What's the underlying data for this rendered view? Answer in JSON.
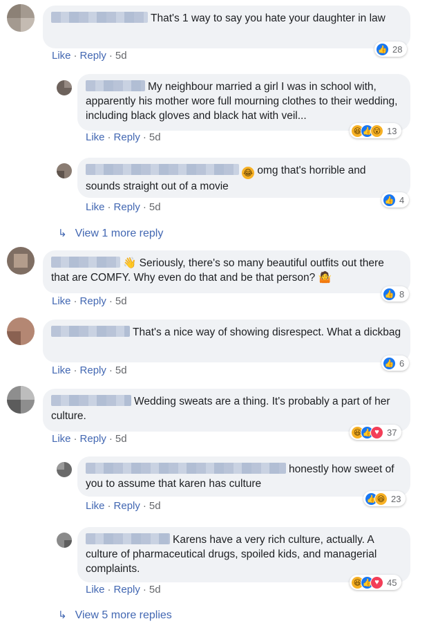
{
  "comments": [
    {
      "text": "That's 1 way to say you hate your daughter in law",
      "reaction_count": "28"
    },
    {
      "text": "My neighbour married a girl I was in school with, apparently his mother wore full mourning clothes to their wedding, including black gloves and black hat with veil...",
      "reaction_count": "13"
    },
    {
      "text": "omg that's horrible and sounds straight out of a movie",
      "reaction_count": "4"
    },
    {
      "text": "Seriously, there's so many beautiful outfits out there that are COMFY. Why even do that and be that person?",
      "reaction_count": "8"
    },
    {
      "text": "That's a nice way of showing disrespect. What a dickbag",
      "reaction_count": "6"
    },
    {
      "text": "Wedding sweats are a thing. It's probably a part of her culture.",
      "reaction_count": "37"
    },
    {
      "text": "honestly how sweet of you to assume that karen has culture",
      "reaction_count": "23"
    },
    {
      "text": "Karens have a very rich culture, actually. A culture of pharmaceutical drugs, spoiled kids, and managerial complaints.",
      "reaction_count": "45"
    }
  ],
  "actions": {
    "like": "Like",
    "reply": "Reply",
    "sep": "·",
    "time": "5d"
  },
  "more_replies": [
    "View 1 more reply",
    "View 5 more replies"
  ],
  "icons": {
    "reply_arrow": "reply-arrow-icon",
    "like": "like-reaction-icon",
    "haha": "haha-reaction-icon",
    "wow": "wow-reaction-icon",
    "love": "love-reaction-icon"
  },
  "colors": {
    "link": "#4267b2",
    "bubble": "#f0f2f5",
    "like": "#1877f2",
    "love": "#f33e58",
    "haha": "#f7b125"
  }
}
